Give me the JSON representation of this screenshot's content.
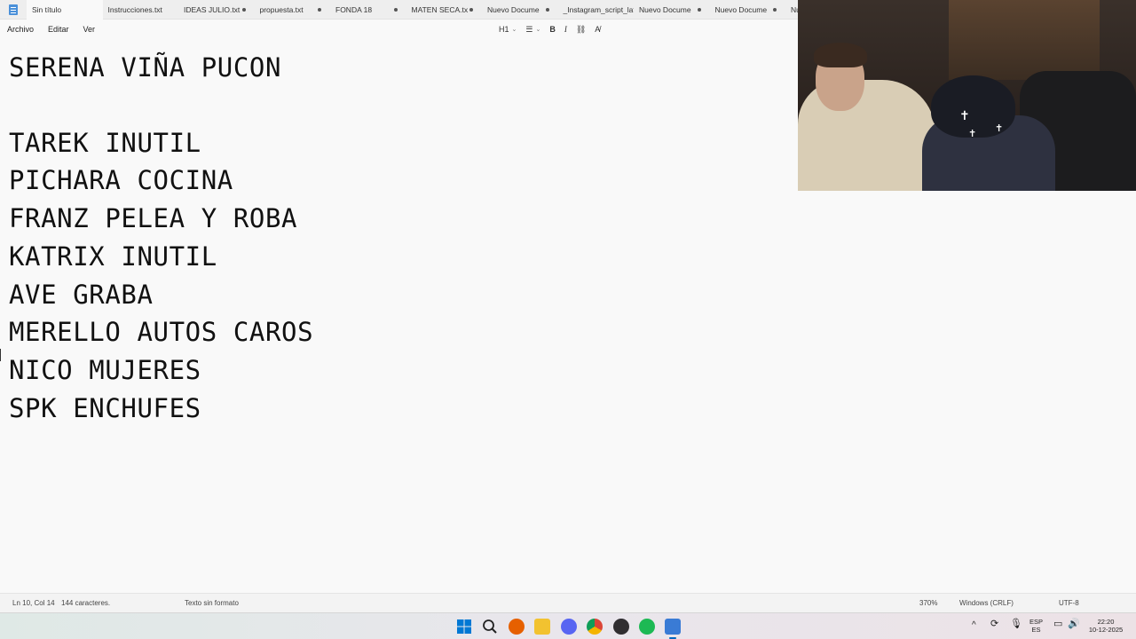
{
  "tabs": [
    {
      "label": "Sin título",
      "active": true,
      "modified": false
    },
    {
      "label": "Instrucciones.txt",
      "active": false,
      "modified": false
    },
    {
      "label": "IDEAS JULIO.txt",
      "active": false,
      "modified": true
    },
    {
      "label": "propuesta.txt",
      "active": false,
      "modified": true
    },
    {
      "label": "FONDA 18",
      "active": false,
      "modified": true
    },
    {
      "label": "MATEN SECA.tx",
      "active": false,
      "modified": true
    },
    {
      "label": "Nuevo Docume",
      "active": false,
      "modified": true
    },
    {
      "label": "_Instagram_script_lat",
      "active": false,
      "modified": false
    },
    {
      "label": "Nuevo Docume",
      "active": false,
      "modified": true
    },
    {
      "label": "Nuevo Docume",
      "active": false,
      "modified": true
    },
    {
      "label": "Nu",
      "active": false,
      "modified": false
    }
  ],
  "menu": {
    "file": "Archivo",
    "edit": "Editar",
    "view": "Ver"
  },
  "toolbar": {
    "heading": "H1",
    "bold": "B",
    "italic": "I"
  },
  "document": {
    "lines": [
      "SERENA VIÑA PUCON",
      "",
      "TAREK INUTIL",
      "PICHARA COCINA",
      "FRANZ PELEA Y ROBA",
      "KATRIX INUTIL",
      "AVE GRABA",
      "MERELLO AUTOS CAROS",
      "NICO MUJERES",
      "SPK ENCHUFES"
    ]
  },
  "status": {
    "position": "Ln 10, Col 14",
    "chars": "144 caracteres.",
    "format": "Texto sin formato",
    "zoom": "370%",
    "line_ending": "Windows (CRLF)",
    "encoding": "UTF-8"
  },
  "taskbar": {
    "icons": [
      "windows-start-icon",
      "search-icon",
      "firefox-icon",
      "file-explorer-icon",
      "discord-icon",
      "chrome-icon",
      "obs-icon",
      "spotify-icon",
      "notepad-icon"
    ],
    "lang_top": "ESP",
    "lang_bottom": "ES",
    "time": "22:20",
    "date": "10-12-2025"
  },
  "colors": {
    "accent": "#0067c0",
    "spotify": "#1db954",
    "firefox": "#e66000"
  }
}
